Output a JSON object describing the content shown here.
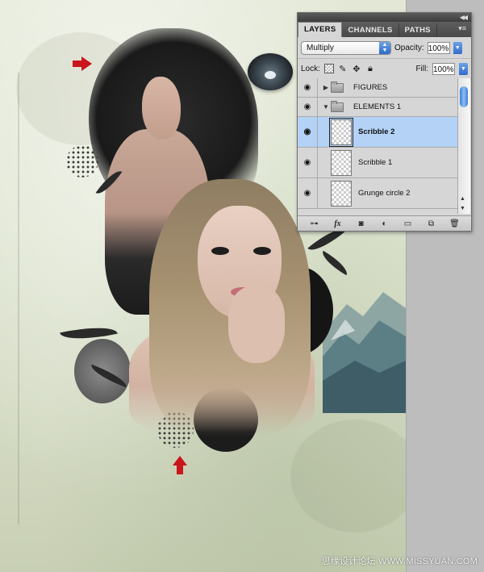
{
  "panel": {
    "tabs": [
      {
        "label": "LAYERS",
        "active": true
      },
      {
        "label": "CHANNELS",
        "active": false
      },
      {
        "label": "PATHS",
        "active": false
      }
    ],
    "blend_mode": "Multiply",
    "opacity_label": "Opacity:",
    "opacity_value": "100%",
    "lock_label": "Lock:",
    "fill_label": "Fill:",
    "fill_value": "100%",
    "layers": [
      {
        "name": "FIGURES",
        "type": "group",
        "expanded": false,
        "visible": true
      },
      {
        "name": "ELEMENTS 1",
        "type": "group",
        "expanded": true,
        "visible": true
      },
      {
        "name": "Scribble 2",
        "type": "layer",
        "selected": true,
        "visible": true
      },
      {
        "name": "Scribble 1",
        "type": "layer",
        "selected": false,
        "visible": true
      },
      {
        "name": "Grunge circle 2",
        "type": "layer",
        "selected": false,
        "visible": true
      }
    ],
    "footer_icons": [
      "link-icon",
      "fx-icon",
      "layer-mask-icon",
      "adjustment-layer-icon",
      "new-group-icon",
      "new-layer-icon",
      "trash-icon"
    ]
  },
  "watermark": "思缘设计论坛 WWW.MISSYUAN.COM",
  "colors": {
    "arrow": "#c9151b",
    "selection": "#b3d2f6",
    "accent_blue": "#2f6cc8"
  }
}
